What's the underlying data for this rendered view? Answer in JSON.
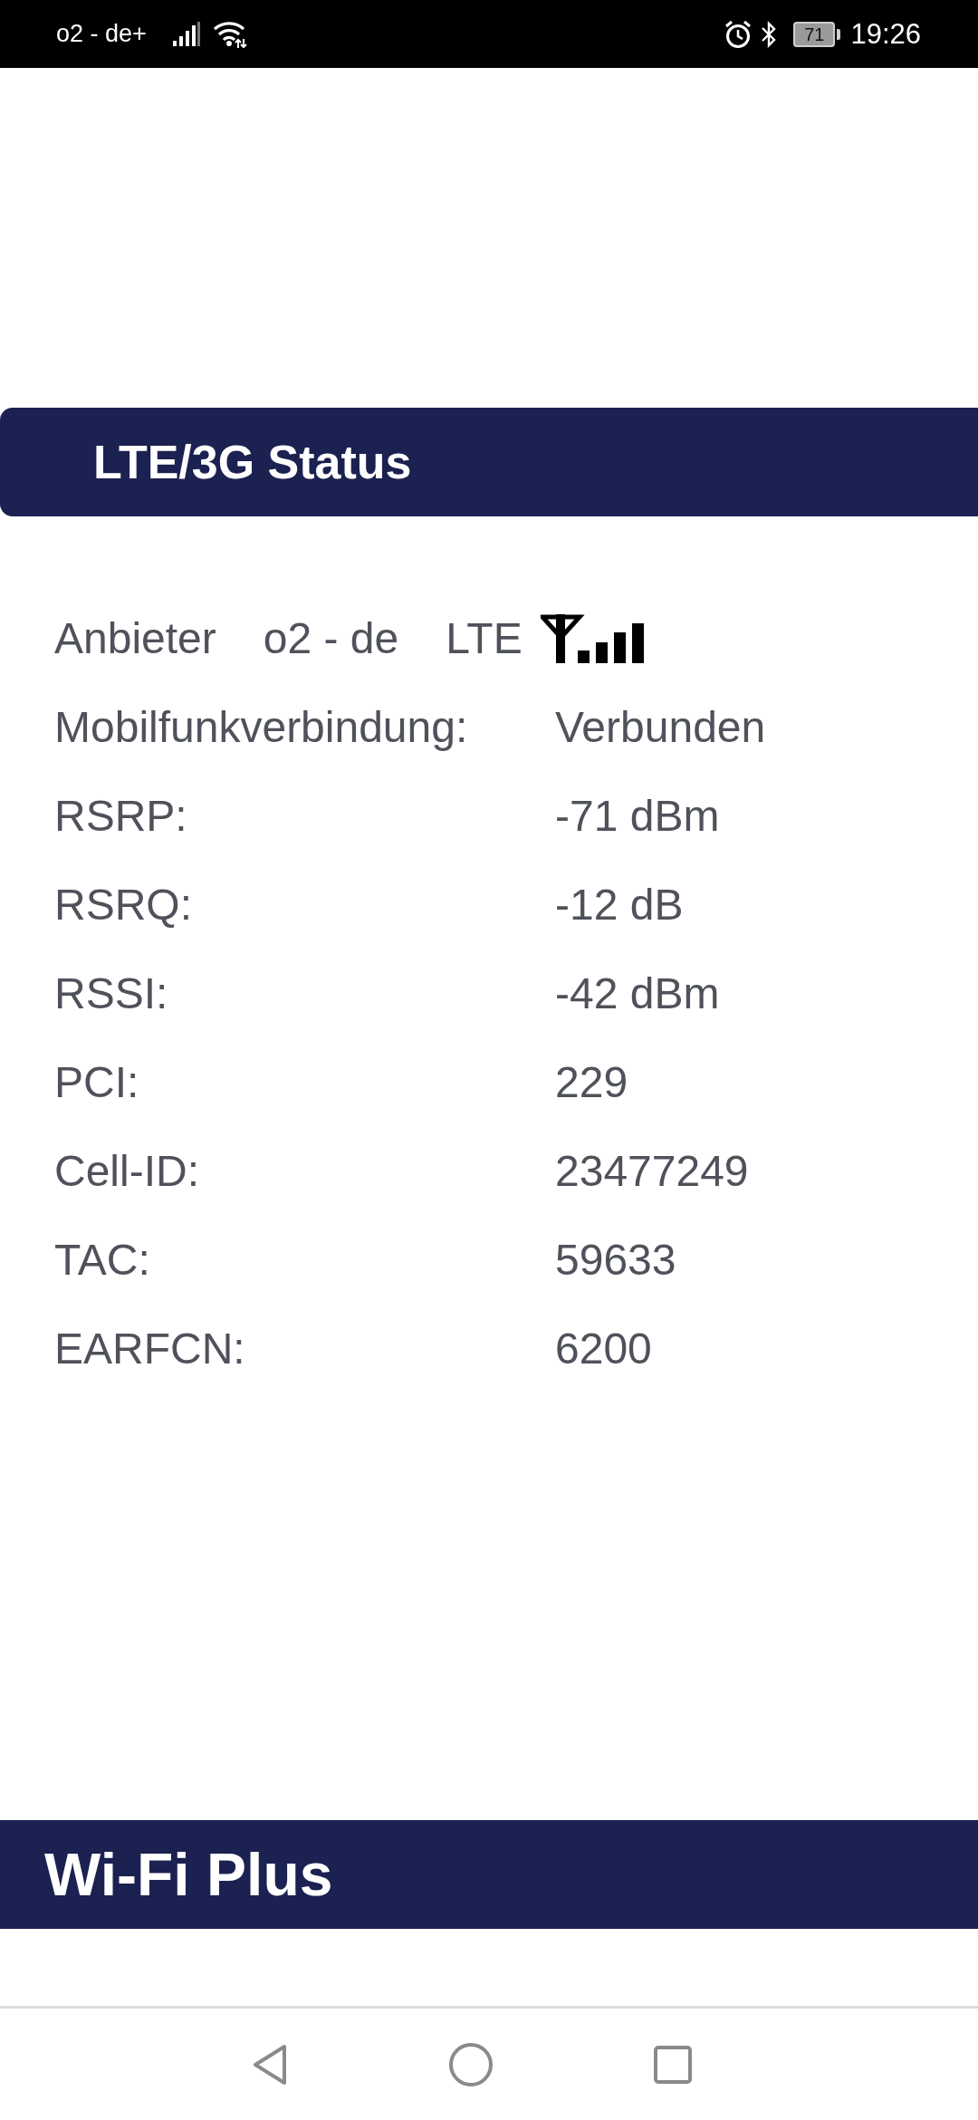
{
  "status_bar": {
    "carrier": "o2 - de+",
    "battery": "71",
    "time": "19:26"
  },
  "header": {
    "title": "LTE/3G Status"
  },
  "provider": {
    "label": "Anbieter",
    "name": "o2 - de",
    "network": "LTE"
  },
  "rows": [
    {
      "label": "Mobilfunkverbindung:",
      "value": "Verbunden"
    },
    {
      "label": "RSRP:",
      "value": "-71 dBm"
    },
    {
      "label": "RSRQ:",
      "value": "-12 dB"
    },
    {
      "label": "RSSI:",
      "value": "-42 dBm"
    },
    {
      "label": "PCI:",
      "value": "229"
    },
    {
      "label": "Cell-ID:",
      "value": "23477249"
    },
    {
      "label": "TAC:",
      "value": "59633"
    },
    {
      "label": "EARFCN:",
      "value": "6200"
    }
  ],
  "section": {
    "title": "Wi-Fi Plus"
  }
}
